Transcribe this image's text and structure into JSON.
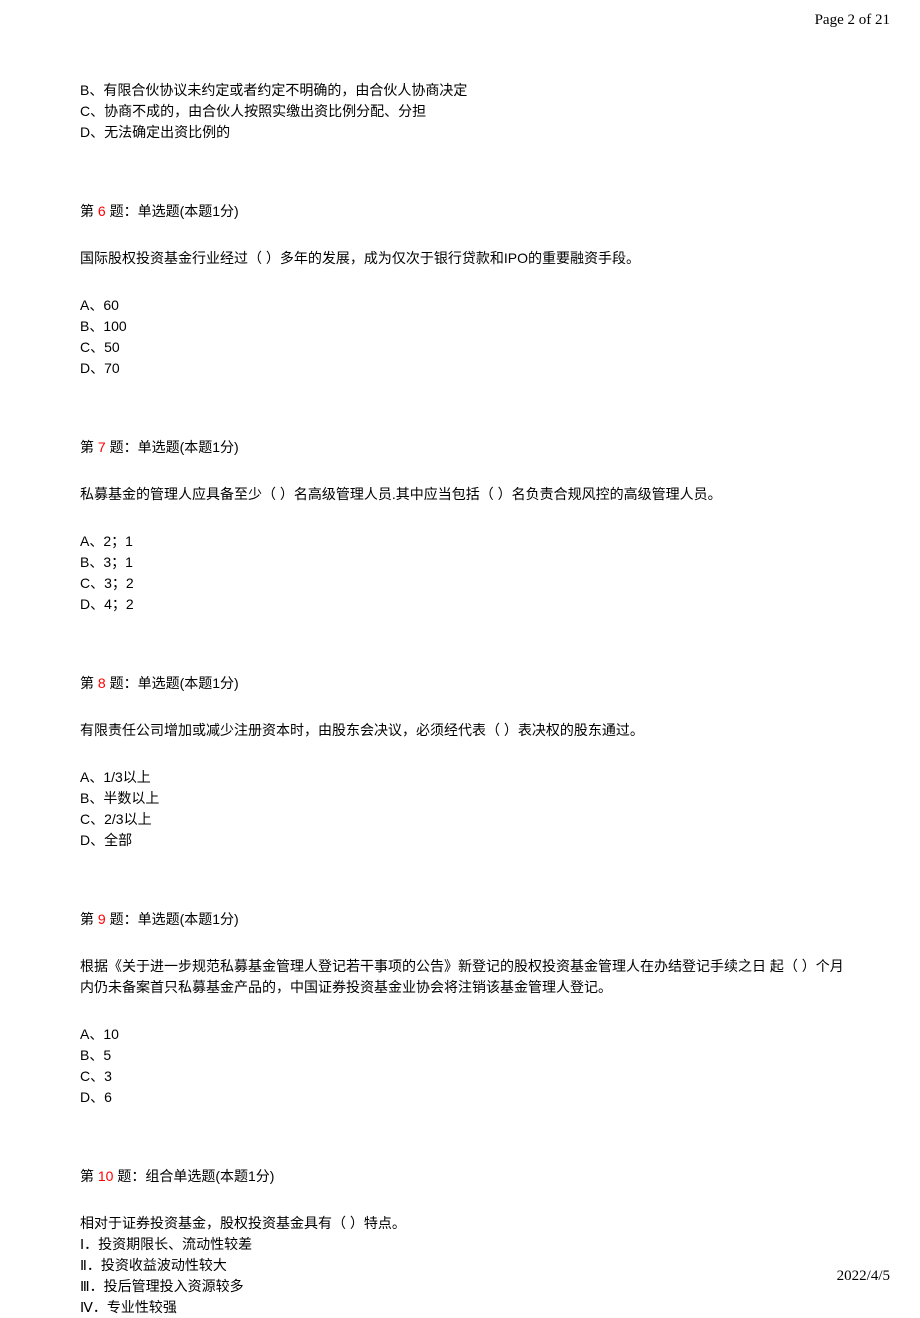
{
  "header": {
    "page_label": "Page 2 of 21"
  },
  "partial_options_q5": {
    "b": "B、有限合伙协议未约定或者约定不明确的，由合伙人协商决定",
    "c": "C、协商不成的，由合伙人按照实缴出资比例分配、分担",
    "d": "D、无法确定出资比例的"
  },
  "q6": {
    "prefix": "第 ",
    "num": "6",
    "suffix": " 题：单选题(本题1分)",
    "text": "国际股权投资基金行业经过（  ）多年的发展，成为仅次于银行贷款和IPO的重要融资手段。",
    "options": {
      "a": "A、60",
      "b": "B、100",
      "c": "C、50",
      "d": "D、70"
    }
  },
  "q7": {
    "prefix": "第 ",
    "num": "7",
    "suffix": " 题：单选题(本题1分)",
    "text": "私募基金的管理人应具备至少（  ）名高级管理人员.其中应当包括（  ）名负责合规风控的高级管理人员。",
    "options": {
      "a": "A、2；1",
      "b": "B、3；1",
      "c": "C、3；2",
      "d": "D、4；2"
    }
  },
  "q8": {
    "prefix": "第 ",
    "num": "8",
    "suffix": " 题：单选题(本题1分)",
    "text": "有限责任公司增加或减少注册资本时，由股东会决议，必须经代表（  ）表决权的股东通过。",
    "options": {
      "a": "A、1/3以上",
      "b": "B、半数以上",
      "c": "C、2/3以上",
      "d": "D、全部"
    }
  },
  "q9": {
    "prefix": "第 ",
    "num": "9",
    "suffix": " 题：单选题(本题1分)",
    "text": "根据《关于进一步规范私募基金管理人登记若干事项的公告》新登记的股权投资基金管理人在办结登记手续之日  起（  ）个月内仍未备案首只私募基金产品的，中国证券投资基金业协会将注销该基金管理人登记。",
    "options": {
      "a": "A、10",
      "b": "B、5",
      "c": "C、3",
      "d": "D、6"
    }
  },
  "q10": {
    "prefix": "第 ",
    "num": "10",
    "suffix": " 题：组合单选题(本题1分)",
    "text": "相对于证券投资基金，股权投资基金具有（  ）特点。",
    "statements": {
      "s1": "Ⅰ．投资期限长、流动性较差",
      "s2": "Ⅱ．投资收益波动性较大",
      "s3": "Ⅲ．投后管理投入资源较多",
      "s4": "Ⅳ．专业性较强"
    }
  },
  "footer": {
    "date": "2022/4/5"
  }
}
